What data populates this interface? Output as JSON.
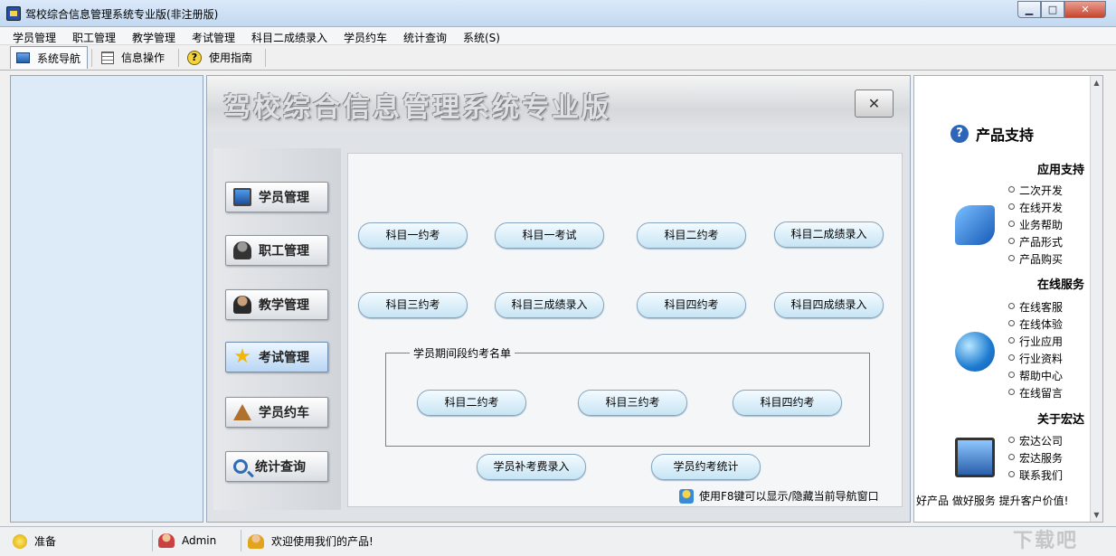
{
  "window": {
    "title": "驾校综合信息管理系统专业版(非注册版)"
  },
  "menu": [
    "学员管理",
    "职工管理",
    "教学管理",
    "考试管理",
    "科目二成绩录入",
    "学员约车",
    "统计查询",
    "系统(S)"
  ],
  "tabs": [
    {
      "label": "系统导航",
      "icon": "monitor-icon"
    },
    {
      "label": "信息操作",
      "icon": "grid-icon"
    },
    {
      "label": "使用指南",
      "icon": "help-icon"
    }
  ],
  "banner": {
    "title": "驾校综合信息管理系统专业版"
  },
  "nav": [
    {
      "label": "学员管理",
      "icon": "monitor-icon"
    },
    {
      "label": "职工管理",
      "icon": "person-icon"
    },
    {
      "label": "教学管理",
      "icon": "teacher-icon"
    },
    {
      "label": "考试管理",
      "icon": "star-icon"
    },
    {
      "label": "学员约车",
      "icon": "house-icon"
    },
    {
      "label": "统计查询",
      "icon": "magnifier-icon"
    }
  ],
  "exam_buttons": {
    "row1": [
      "科目一约考",
      "科目一考试",
      "科目二约考",
      "科目二成绩录入"
    ],
    "row2": [
      "科目三约考",
      "科目三成绩录入",
      "科目四约考",
      "科目四成绩录入"
    ]
  },
  "group": {
    "legend": "学员期间段约考名单",
    "buttons": [
      "科目二约考",
      "科目三约考",
      "科目四约考"
    ]
  },
  "bottom_buttons": [
    "学员补考费录入",
    "学员约考统计"
  ],
  "hint": "使用F8键可以显示/隐藏当前导航窗口",
  "support": {
    "title": "产品支持",
    "sections": [
      {
        "heading": "应用支持",
        "links": [
          "二次开发",
          "在线开发",
          "业务帮助",
          "产品形式",
          "产品购买"
        ]
      },
      {
        "heading": "在线服务",
        "links": [
          "在线客服",
          "在线体验",
          "行业应用",
          "行业资料",
          "帮助中心",
          "在线留言"
        ]
      },
      {
        "heading": "关于宏达",
        "links": [
          "宏达公司",
          "宏达服务",
          "联系我们"
        ]
      }
    ],
    "slogan": "好产品 做好服务 提升客户价值!"
  },
  "status": {
    "state": "准备",
    "user": "Admin",
    "welcome": "欢迎使用我们的产品!"
  },
  "watermark": "下载吧"
}
